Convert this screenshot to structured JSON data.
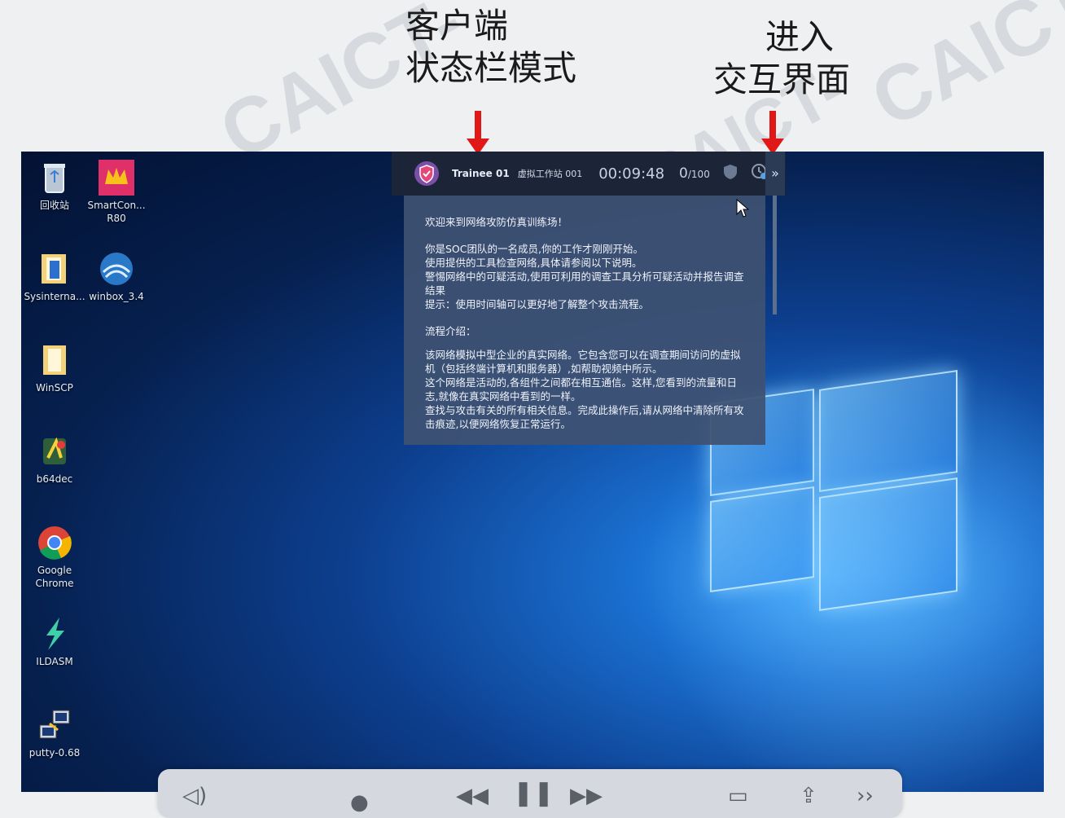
{
  "callouts": {
    "left_line1": "客户端",
    "left_line2": "状态栏模式",
    "right_line1": "进入",
    "right_line2": "交互界面"
  },
  "watermark": "CAICT-",
  "desktop_icons": [
    {
      "label": "回收站",
      "icon": "recycle-bin-icon"
    },
    {
      "label": "SmartCon... R80",
      "icon": "smartconsole-icon"
    },
    {
      "label": "Sysinterna...",
      "icon": "folder-icon"
    },
    {
      "label": "winbox_3.4",
      "icon": "winbox-icon"
    },
    {
      "label": "WinSCP",
      "icon": "folder-icon"
    },
    {
      "label": "b64dec",
      "icon": "b64dec-icon"
    },
    {
      "label": "Google Chrome",
      "icon": "chrome-icon"
    },
    {
      "label": "ILDASM",
      "icon": "ildasm-icon"
    },
    {
      "label": "putty-0.68",
      "icon": "putty-icon"
    }
  ],
  "statusbar": {
    "trainee": "Trainee 01",
    "station": "虚拟工作站 001",
    "timer": "00:09:48",
    "score": "0",
    "score_total": "/100",
    "expand": "»"
  },
  "panel": {
    "welcome": "欢迎来到网络攻防仿真训练场！",
    "intro": "你是SOC团队的一名成员,你的工作才刚刚开始。\n使用提供的工具检查网络,具体请参阅以下说明。\n警惕网络中的可疑活动,使用可利用的调查工具分析可疑活动并报告调查结果\n提示：使用时间轴可以更好地了解整个攻击流程。",
    "process_title": "流程介绍：",
    "process_body": "该网络模拟中型企业的真实网络。它包含您可以在调查期间访问的虚拟机（包括终端计算机和服务器）,如帮助视频中所示。\n这个网络是活动的,各组件之间都在相互通信。这样,您看到的流量和日志,就像在真实网络中看到的一样。\n查找与攻击有关的所有相关信息。完成此操作后,请从网络中清除所有攻击痕迹,以便网络恢复正常运行。"
  },
  "colors": {
    "arrow": "#e01818",
    "statusbar_bg": "#1c2537",
    "panel_bg": "#3e5272"
  }
}
